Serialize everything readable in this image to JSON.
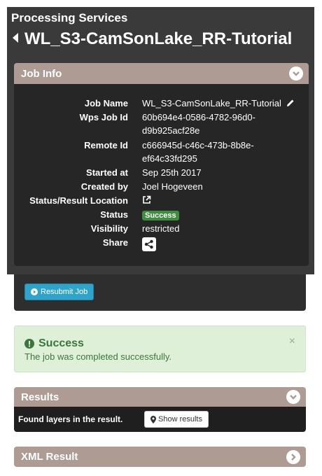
{
  "header": {
    "title": "Processing Services",
    "job_title": "WL_S3-CamSonLake_RR-Tutorial",
    "back_icon": "caret-left-icon"
  },
  "job_info": {
    "title": "Job Info",
    "rows": {
      "job_name": {
        "label": "Job Name",
        "value": "WL_S3-CamSonLake_RR-Tutorial"
      },
      "wps_job_id": {
        "label": "Wps Job Id",
        "value_line1": "60b694e4-0586-4782-96d0-",
        "value_line2": "d9b925acf28e"
      },
      "remote_id": {
        "label": "Remote Id",
        "value_line1": "c666945d-c46c-473b-8b8e-",
        "value_line2": "ef64c33fd295"
      },
      "started_at": {
        "label": "Started at",
        "value": "Sep 25th 2017"
      },
      "created_by": {
        "label": "Created by",
        "value": "Joel Hogeveen"
      },
      "location": {
        "label": "Status/Result Location"
      },
      "status": {
        "label": "Status",
        "value": "Success"
      },
      "visibility": {
        "label": "Visibility",
        "value": "restricted"
      },
      "share": {
        "label": "Share"
      }
    },
    "resubmit_label": "Resubmit Job"
  },
  "alert": {
    "title": "Success",
    "message": "The job was completed successfully.",
    "close": "×"
  },
  "results": {
    "title": "Results",
    "found_text": "Found layers in the result.",
    "show_label": "Show results"
  },
  "xml_result": {
    "title": "XML Result"
  },
  "colors": {
    "panel_head": "#ad9b94",
    "dark_bg": "#3a3a3a",
    "success_badge": "#3f8d3f",
    "alert_bg": "#def0d8",
    "alert_text": "#3c763d",
    "resubmit_btn": "#2fa3c9"
  }
}
